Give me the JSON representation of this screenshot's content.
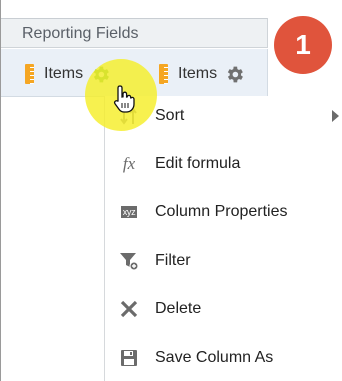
{
  "panel": {
    "title": "Reporting Fields"
  },
  "fields": [
    {
      "label": "Items"
    },
    {
      "label": "Items"
    }
  ],
  "callout": {
    "number": "1"
  },
  "context_menu": {
    "items": [
      {
        "label": "Sort",
        "icon": "sort-icon",
        "has_submenu": true
      },
      {
        "label": "Edit formula",
        "icon": "formula-icon"
      },
      {
        "label": "Column Properties",
        "icon": "column-properties-icon",
        "icon_text": "xyz"
      },
      {
        "label": "Filter",
        "icon": "filter-icon"
      },
      {
        "label": "Delete",
        "icon": "delete-icon"
      },
      {
        "label": "Save Column As",
        "icon": "save-icon"
      }
    ]
  },
  "colors": {
    "callout": "#e0543c",
    "highlight": "#f5ee28",
    "field_icon": "#f5a623",
    "gear_active": "#5bb04a",
    "gear": "#707070"
  }
}
